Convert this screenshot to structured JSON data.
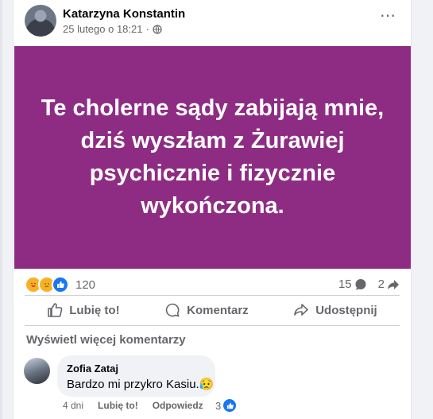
{
  "post": {
    "author": "Katarzyna Konstantin",
    "timestamp": "25 lutego o 18:21",
    "separator": "·",
    "more_icon": "⋯",
    "text": "Te cholerne sądy zabijają mnie, dziś wyszłam z Żurawiej psychicznie i fizycznie wykończona.",
    "background_color": "#8e2c84"
  },
  "stats": {
    "reactions_count": "120",
    "comments_count": "15",
    "shares_count": "2",
    "reaction_icons": [
      "care-icon",
      "sad-icon",
      "like-icon"
    ]
  },
  "actions": {
    "like": "Lubię to!",
    "comment": "Komentarz",
    "share": "Udostępnij"
  },
  "comments": {
    "view_more": "Wyświetl więcej komentarzy",
    "items": [
      {
        "name": "Zofia Zataj",
        "text": "Bardzo mi przykro Kasiu.",
        "emoji": "😥",
        "age": "4 dni",
        "like_label": "Lubię to!",
        "reply_label": "Odpowiedz",
        "like_count": "3"
      }
    ]
  },
  "colors": {
    "accent": "#1877f2",
    "muted_text": "#65676b"
  }
}
